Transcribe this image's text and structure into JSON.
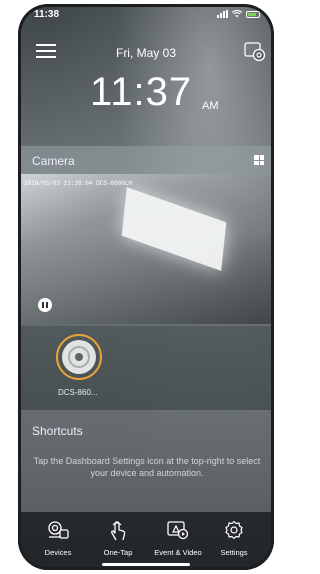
{
  "status_bar": {
    "time": "11:38"
  },
  "header": {
    "date": "Fri, May 03",
    "time": "11:37",
    "ampm": "AM"
  },
  "camera": {
    "title": "Camera",
    "timestamp": "2019/05/03   11:38:04   DCS-8600LH"
  },
  "devices": [
    {
      "label": "DCS-860..."
    }
  ],
  "shortcuts": {
    "title": "Shortcuts",
    "hint": "Tap the Dashboard Settings icon at the top-right to select your device and automation."
  },
  "tabs": [
    {
      "label": "Devices",
      "icon": "devices-icon"
    },
    {
      "label": "One-Tap",
      "icon": "one-tap-icon"
    },
    {
      "label": "Event & Video",
      "icon": "event-video-icon"
    },
    {
      "label": "Settings",
      "icon": "settings-icon"
    }
  ]
}
